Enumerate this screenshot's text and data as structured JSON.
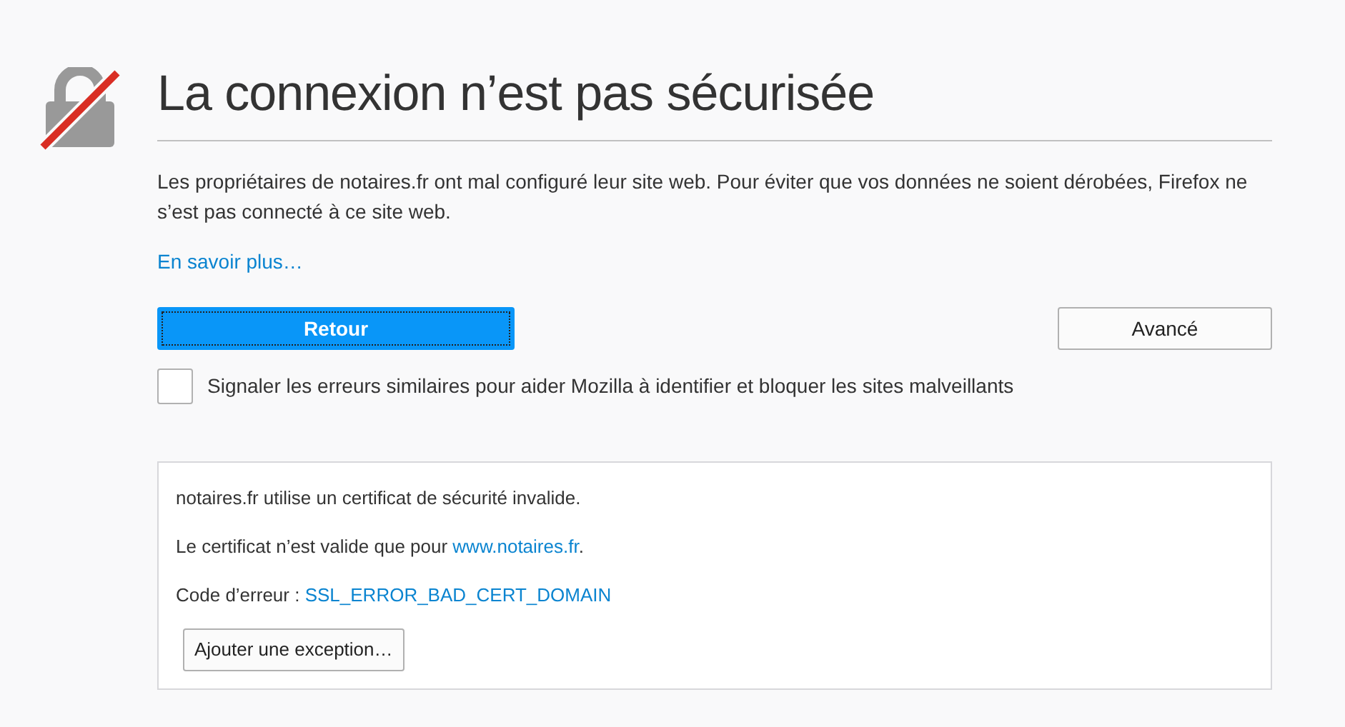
{
  "title": "La connexion n’est pas sécurisée",
  "description": "Les propriétaires de notaires.fr ont mal configuré leur site web. Pour éviter que vos données ne soient dérobées, Firefox ne s’est pas connecté à ce site web.",
  "learn_more_link": "En savoir plus…",
  "buttons": [
    {
      "label": "Retour",
      "kind": "primary"
    },
    {
      "label": "Avancé",
      "kind": "secondary"
    }
  ],
  "report_checkbox": {
    "label": "Signaler les erreurs similaires pour aider Mozilla à identifier et bloquer les sites malveillants",
    "checked": false
  },
  "advanced_panel": {
    "lines": [
      {
        "text": "notaires.fr utilise un certificat de sécurité invalide."
      },
      {
        "text": "Le certificat n’est valide que pour ",
        "link": "www.notaires.fr",
        "after": "."
      },
      {
        "text": "Code d’erreur : ",
        "link": "SSL_ERROR_BAD_CERT_DOMAIN"
      }
    ],
    "button": "Ajouter une exception…"
  }
}
